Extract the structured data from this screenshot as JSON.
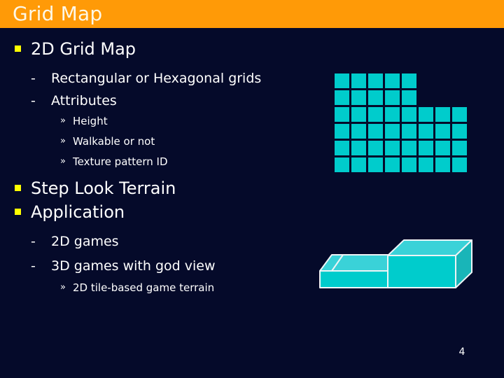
{
  "slide": {
    "title": "Grid Map",
    "page_number": "4",
    "colors": {
      "title_bar": "#ff9a07",
      "title_text": "#fdf7e6",
      "background": "#050a2a",
      "body_text": "#ffffff",
      "bullet_square": "#ffff00",
      "tile_fill": "#00cccc",
      "tile_border": "#e8eef0",
      "block_top": "#3ad2d8",
      "block_front": "#00cccc",
      "block_side": "#19b5b8",
      "block_edge": "#eef4f6"
    }
  },
  "outline": [
    {
      "level": 1,
      "bullet": "square",
      "text": "2D Grid Map"
    },
    {
      "level": 2,
      "bullet": "dash",
      "text": "Rectangular or Hexagonal grids"
    },
    {
      "level": 2,
      "bullet": "dash",
      "text": "Attributes"
    },
    {
      "level": 3,
      "bullet": "guillemet",
      "text": "Height"
    },
    {
      "level": 3,
      "bullet": "guillemet",
      "text": "Walkable or not"
    },
    {
      "level": 3,
      "bullet": "guillemet",
      "text": "Texture pattern ID"
    },
    {
      "level": 1,
      "bullet": "square",
      "text": "Step Look Terrain"
    },
    {
      "level": 1,
      "bullet": "square",
      "text": "Application"
    },
    {
      "level": 2,
      "bullet": "dash",
      "text": "2D games"
    },
    {
      "level": 2,
      "bullet": "dash",
      "text": "3D games with god view"
    },
    {
      "level": 3,
      "bullet": "guillemet",
      "text": "2D tile-based game terrain"
    }
  ],
  "bullet_glyphs": {
    "dash": "-",
    "guillemet": "»"
  },
  "grid_figure": {
    "name": "l-shaped-tile-grid",
    "rows": [
      {
        "columns": 5
      },
      {
        "columns": 5
      },
      {
        "columns": 8
      },
      {
        "columns": 8
      },
      {
        "columns": 8
      },
      {
        "columns": 8
      }
    ],
    "cell_size": 24,
    "gap": 3
  },
  "blocks_figure": {
    "name": "step-look-terrain-blocks",
    "blocks": [
      {
        "label": "low-step-block",
        "height": "low"
      },
      {
        "label": "high-step-block",
        "height": "high"
      }
    ]
  }
}
